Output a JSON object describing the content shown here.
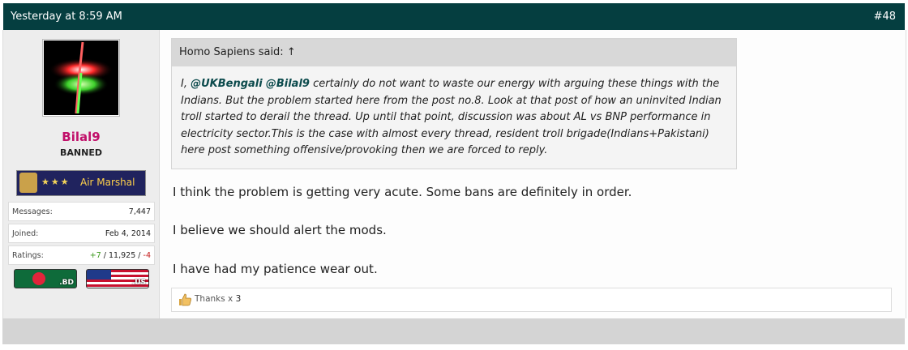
{
  "header": {
    "date": "Yesterday at 8:59 AM",
    "post_number": "#48"
  },
  "user": {
    "name": "Bilal9",
    "title": "BANNED",
    "rank": {
      "stars": "★★★",
      "label": "Air Marshal"
    },
    "stats": [
      {
        "label": "Messages:",
        "value": "7,447"
      },
      {
        "label": "Joined:",
        "value": "Feb 4, 2014"
      }
    ],
    "ratings": {
      "label": "Ratings:",
      "positive": "+7",
      "neutral": "11,925",
      "negative": "-4",
      "sep": " / "
    },
    "flags": [
      {
        "code": ".BD"
      },
      {
        "code": ".US"
      }
    ]
  },
  "quote": {
    "author": "Homo Sapiens said:",
    "arrow": "↑",
    "text_prefix": "I, ",
    "mention1": "@UKBengali",
    "mention2": "@Bilal9",
    "text_rest": " certainly do not want to waste our energy with arguing these things with the Indians. But the problem started here from the post no.8. Look at that post of how an uninvited Indian troll started to derail the thread. Up until that point, discussion was about AL vs BNP performance in electricity sector.This is the case with almost every thread, resident troll brigade(Indians+Pakistani) here post something offensive/provoking then we are forced to reply."
  },
  "message": [
    "I think the problem is getting very acute. Some bans are definitely in order.",
    "I believe we should alert the mods.",
    "I have had my patience wear out."
  ],
  "thanks": {
    "label": "Thanks x ",
    "count": "3"
  },
  "colors": {
    "header_bg": "#053e40",
    "username": "#c1106a",
    "mention": "#0b4a4c"
  }
}
